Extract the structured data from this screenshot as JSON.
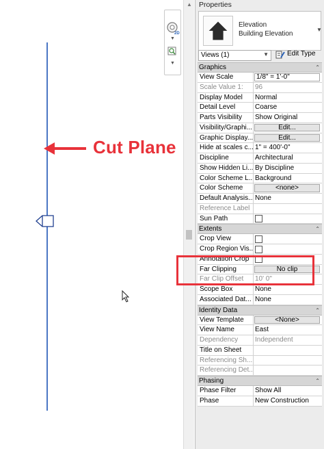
{
  "annotation": {
    "cut_plane_label": "Cut Plane",
    "accent_color": "#e8323a",
    "line_color": "#4a76c4"
  },
  "properties": {
    "title": "Properties",
    "type_selector": {
      "family": "Elevation",
      "type": "Building Elevation",
      "icon": "elevation-house-icon"
    },
    "instance_selector": "Views (1)",
    "edit_type_label": "Edit Type",
    "sections": {
      "graphics": {
        "label": "Graphics",
        "rows": [
          {
            "key": "View Scale",
            "value": "1/8\" = 1'-0\""
          },
          {
            "key": "Scale Value    1:",
            "value": "96"
          },
          {
            "key": "Display Model",
            "value": "Normal"
          },
          {
            "key": "Detail Level",
            "value": "Coarse"
          },
          {
            "key": "Parts Visibility",
            "value": "Show Original"
          },
          {
            "key": "Visibility/Graphi...",
            "value": "Edit..."
          },
          {
            "key": "Graphic Display...",
            "value": "Edit..."
          },
          {
            "key": "Hide at scales c...",
            "value": "1\" = 400'-0\""
          },
          {
            "key": "Discipline",
            "value": "Architectural"
          },
          {
            "key": "Show Hidden Li...",
            "value": "By Discipline"
          },
          {
            "key": "Color Scheme L...",
            "value": "Background"
          },
          {
            "key": "Color Scheme",
            "value": "<none>"
          },
          {
            "key": "Default Analysis...",
            "value": "None"
          },
          {
            "key": "Reference Label",
            "value": ""
          },
          {
            "key": "Sun Path",
            "value": ""
          }
        ]
      },
      "extents": {
        "label": "Extents",
        "rows": [
          {
            "key": "Crop View",
            "value": ""
          },
          {
            "key": "Crop Region Vis...",
            "value": ""
          },
          {
            "key": "Annotation Crop",
            "value": ""
          },
          {
            "key": "Far Clipping",
            "value": "No clip"
          },
          {
            "key": "Far Clip Offset",
            "value": "10'  0\""
          },
          {
            "key": "Scope Box",
            "value": "None"
          },
          {
            "key": "Associated Dat...",
            "value": "None"
          }
        ]
      },
      "identity": {
        "label": "Identity Data",
        "rows": [
          {
            "key": "View Template",
            "value": "<None>"
          },
          {
            "key": "View Name",
            "value": "East"
          },
          {
            "key": "Dependency",
            "value": "Independent"
          },
          {
            "key": "Title on Sheet",
            "value": ""
          },
          {
            "key": "Referencing Sh...",
            "value": ""
          },
          {
            "key": "Referencing Det...",
            "value": ""
          }
        ]
      },
      "phasing": {
        "label": "Phasing",
        "rows": [
          {
            "key": "Phase Filter",
            "value": "Show All"
          },
          {
            "key": "Phase",
            "value": "New Construction"
          }
        ]
      }
    }
  },
  "navbar": {
    "wheel_label": "2D",
    "icons": [
      "steering-wheel-icon",
      "zoom-icon"
    ]
  }
}
